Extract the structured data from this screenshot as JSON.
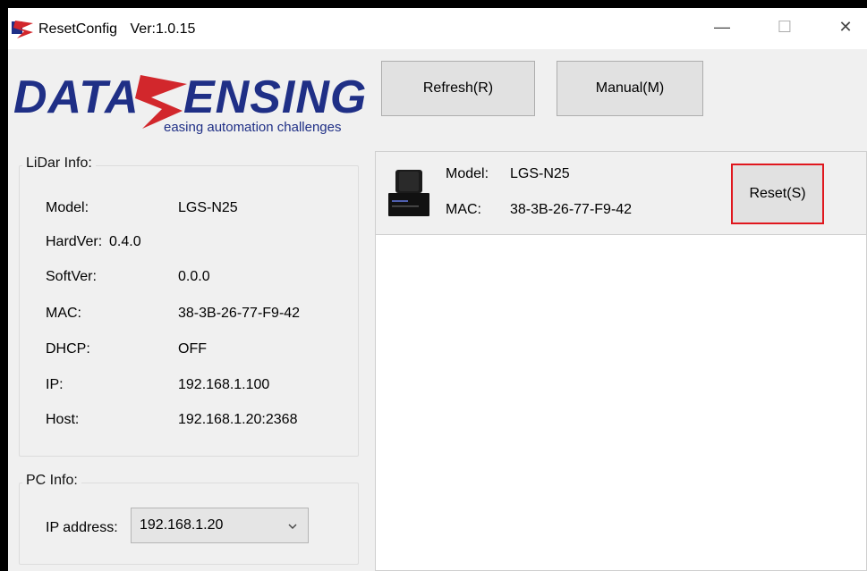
{
  "window": {
    "title": "ResetConfig",
    "version": "Ver:1.0.15",
    "controls": {
      "minimize": "—",
      "maximize": "☐",
      "close": "✕"
    }
  },
  "logo": {
    "brand": "DATASENSING",
    "tagline": "easing automation challenges",
    "colors": {
      "navy": "#1f2f86",
      "red": "#d2272c"
    }
  },
  "toolbar": {
    "refresh_label": "Refresh(R)",
    "manual_label": "Manual(M)"
  },
  "lidar_info": {
    "title": "LiDar Info:",
    "rows": [
      {
        "label": "Model:",
        "value": "LGS-N25"
      },
      {
        "label": "HardVer:",
        "value": "0.4.0"
      },
      {
        "label": "SoftVer:",
        "value": "0.0.0"
      },
      {
        "label": "MAC:",
        "value": "38-3B-26-77-F9-42"
      },
      {
        "label": "DHCP:",
        "value": "OFF"
      },
      {
        "label": "IP:",
        "value": "192.168.1.100"
      },
      {
        "label": "Host:",
        "value": "192.168.1.20:2368"
      }
    ]
  },
  "pc_info": {
    "title": "PC Info:",
    "ip_label": "IP address:",
    "ip_selected": "192.168.1.20"
  },
  "devices": [
    {
      "model_label": "Model:",
      "model": "LGS-N25",
      "mac_label": "MAC:",
      "mac": "38-3B-26-77-F9-42",
      "reset_label": "Reset(S)",
      "highlight_color": "#e0171e"
    }
  ]
}
